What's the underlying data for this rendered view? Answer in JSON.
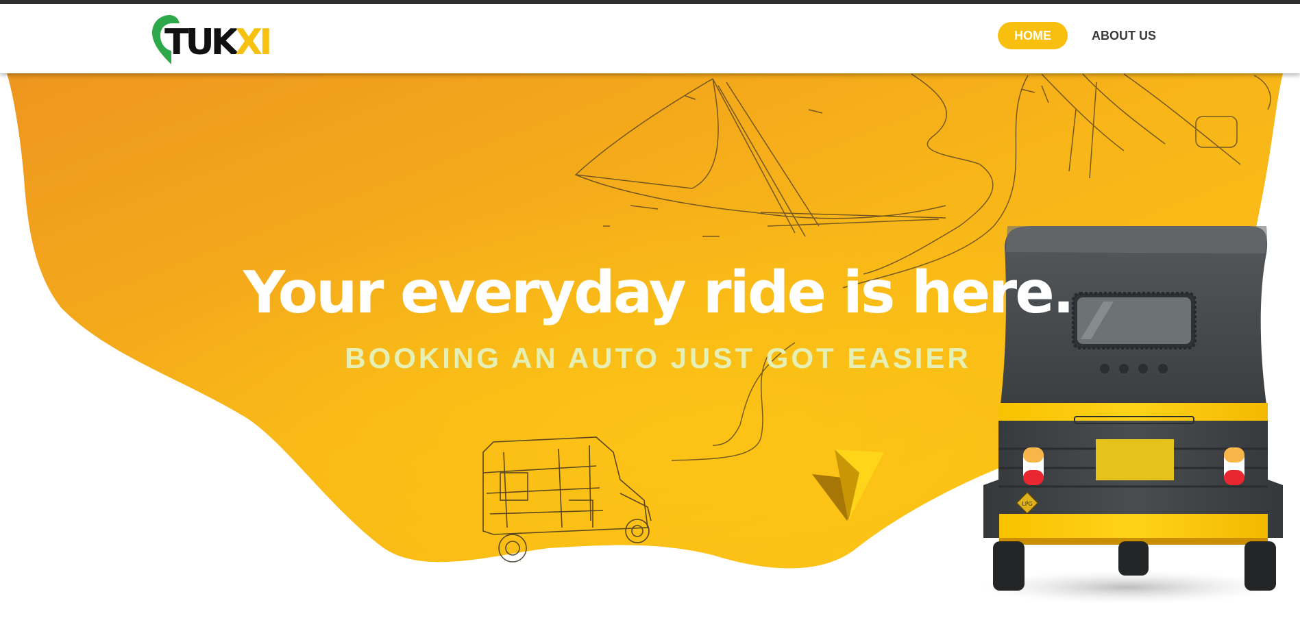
{
  "brand": {
    "logo_main": "TUK",
    "logo_accent": "XI",
    "logo_icon": "map-pin-icon"
  },
  "nav": {
    "home_label": "HOME",
    "about_label": "ABOUT US"
  },
  "hero": {
    "title": "Your everyday ride is here.",
    "subtitle": "BOOKING AN AUTO JUST GOT EASIER"
  },
  "colors": {
    "accent": "#f9bf0e",
    "hero_gradient_start": "#ee961f",
    "hero_gradient_end": "#fcc514",
    "subtitle": "#e6efb4",
    "logo_green": "#2da84a"
  }
}
